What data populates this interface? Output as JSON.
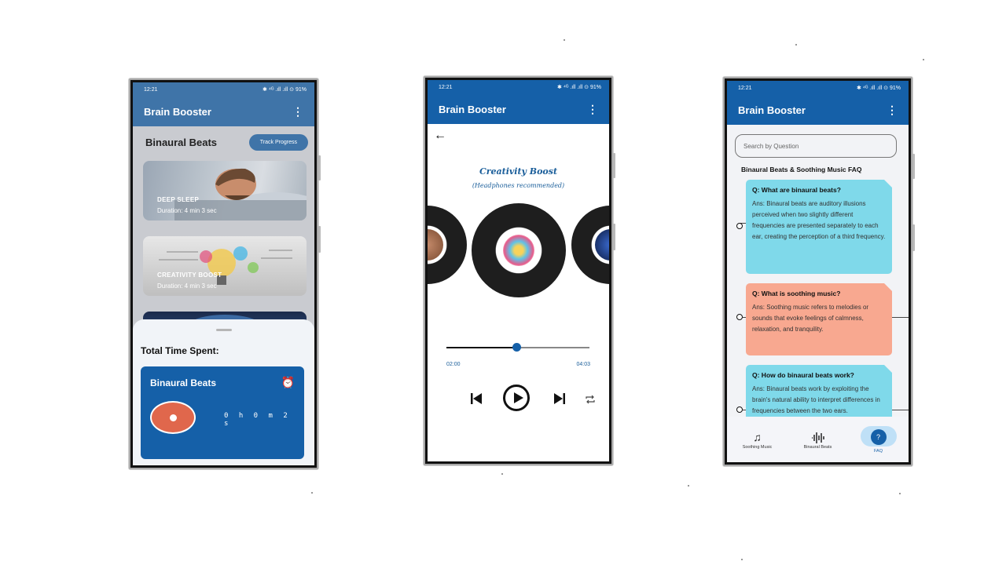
{
  "status": {
    "time": "12:21",
    "right": "✱ ⁴ᴳ .ıll .ıll ⊙ 91%"
  },
  "app": {
    "title": "Brain Booster",
    "menu_icon": "kebab-icon"
  },
  "screen1": {
    "header": "Binaural Beats",
    "track_progress_label": "Track Progress",
    "cards": [
      {
        "label": "DEEP SLEEP",
        "duration": "Duration: 4 min 3 sec"
      },
      {
        "label": "CREATIVITY BOOST",
        "duration": "Duration: 4 min 3 sec"
      }
    ],
    "sheet": {
      "title": "Total Time Spent:",
      "card_title": "Binaural Beats",
      "time": "0 h 0 m 2 s"
    }
  },
  "screen2": {
    "track_title": "Creativity Boost",
    "subtitle": "(Headphones recommended)",
    "elapsed": "02:00",
    "total": "04:03",
    "progress": 0.49
  },
  "screen3": {
    "search_placeholder": "Search by Question",
    "faq_title": "Binaural Beats & Soothing Music FAQ",
    "faqs": [
      {
        "q": "Q: What are binaural beats?",
        "a": "Ans: Binaural beats are auditory illusions perceived when two slightly different frequencies are presented separately to each ear, creating the perception of a third frequency.",
        "color": "#7fd9ea"
      },
      {
        "q": "Q: What is soothing music?",
        "a": "Ans: Soothing music refers to melodies or sounds that evoke feelings of calmness, relaxation, and tranquility.",
        "color": "#f8a890"
      },
      {
        "q": "Q: How do binaural beats work?",
        "a": "Ans: Binaural beats work by exploiting the brain's natural ability to interpret differences in frequencies between the two ears.",
        "color": "#7fd9ea"
      }
    ],
    "nav": [
      {
        "label": "Soothing Music",
        "icon": "music-notes-icon"
      },
      {
        "label": "Binaural Beats",
        "icon": "waveform-icon"
      },
      {
        "label": "FAQ",
        "icon": "faq-icon"
      }
    ]
  }
}
